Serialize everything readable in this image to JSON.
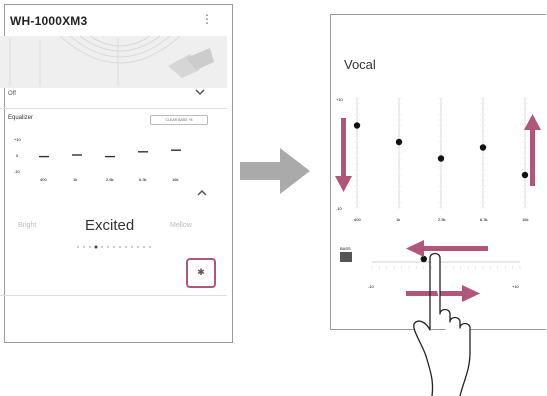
{
  "left_phone": {
    "app_title": "WH-1000XM3",
    "menu_icon": "kebab-icon",
    "mode_value": "Off",
    "equalizer_label": "Equalizer",
    "clear_bass_badge": "CLEAR BASS  +8",
    "mini_eq": {
      "ytick_labels": [
        "+10",
        "0",
        "-10"
      ],
      "band_labels": [
        "400",
        "1k",
        "2.5k",
        "6.3k",
        "16k"
      ],
      "levels": [
        -1,
        0,
        -1,
        2,
        3
      ]
    },
    "presets": {
      "previous": "Bright",
      "current": "Excited",
      "next": "Mellow"
    },
    "page_dots": {
      "count": 13,
      "active_index": 3
    },
    "settings_icon": "gear-icon"
  },
  "right_phone": {
    "preset_title": "Vocal",
    "eq": {
      "top_label": "+10",
      "bottom_label": "-10",
      "band_labels": [
        "400",
        "1k",
        "2.5k",
        "6.3k",
        "16k"
      ],
      "levels": [
        5,
        2,
        -1,
        1,
        -4
      ],
      "range": [
        -10,
        10
      ]
    },
    "clear_bass": {
      "label": "BASS",
      "min_label": "-10",
      "max_label": "+10",
      "value": -3
    }
  },
  "colors": {
    "accent": "#b0567a",
    "arrow": "#aaaaaa"
  }
}
